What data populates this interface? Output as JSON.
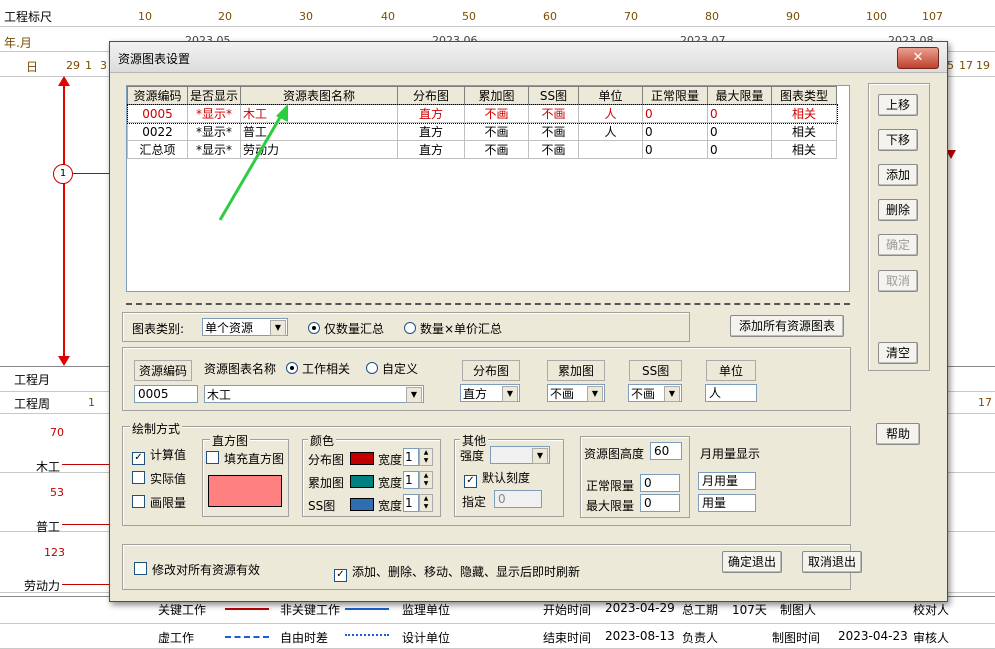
{
  "background": {
    "ruler_label": "工程标尺",
    "ruler_ticks": [
      "10",
      "20",
      "30",
      "40",
      "50",
      "60",
      "70",
      "80",
      "90",
      "100",
      "107"
    ],
    "month_label": "年.月",
    "months": [
      "2023.05",
      "2023.06",
      "2023.07",
      "2023.08"
    ],
    "day_label": "日",
    "days_left": [
      "29",
      "1",
      "3"
    ],
    "days_right": [
      "5",
      "17",
      "19"
    ],
    "node_label": "1",
    "eng_month_label": "工程月",
    "eng_week_label": "工程周",
    "eng_week_first": "1",
    "eng_week_last": "17",
    "resources": [
      {
        "value": "70",
        "name": "木工"
      },
      {
        "value": "53",
        "name": "普工"
      },
      {
        "value": "123",
        "name": "劳动力"
      }
    ],
    "legend": {
      "key_work": "关键工作",
      "non_key_work": "非关键工作",
      "supervisor": "监理单位",
      "start_time_label": "开始时间",
      "start_time": "2023-04-29",
      "total_duration_label": "总工期",
      "total_duration": "107天",
      "drafter_label": "制图人",
      "checker_label": "校对人",
      "virtual_work": "虚工作",
      "free_float": "自由时差",
      "design_unit": "设计单位",
      "end_time_label": "结束时间",
      "end_time": "2023-08-13",
      "owner_label": "负责人",
      "draw_time_label": "制图时间",
      "draw_time": "2023-04-23",
      "reviewer_label": "审核人"
    }
  },
  "dialog": {
    "title": "资源图表设置",
    "close_label": "✕",
    "table": {
      "headers": [
        "资源编码",
        "是否显示",
        "资源表图名称",
        "分布图",
        "累加图",
        "SS图",
        "单位",
        "正常限量",
        "最大限量",
        "图表类型"
      ],
      "rows": [
        [
          "0005",
          "*显示*",
          "木工",
          "直方",
          "不画",
          "不画",
          "人",
          "0",
          "0",
          "相关"
        ],
        [
          "0022",
          "*显示*",
          "普工",
          "直方",
          "不画",
          "不画",
          "人",
          "0",
          "0",
          "相关"
        ],
        [
          "汇总项",
          "*显示*",
          "劳动力",
          "直方",
          "不画",
          "不画",
          "",
          "0",
          "0",
          "相关"
        ]
      ]
    },
    "side_buttons": {
      "up": "上移",
      "down": "下移",
      "add": "添加",
      "delete": "删除",
      "confirm": "确定",
      "cancel": "取消",
      "clear": "清空",
      "help": "帮助"
    },
    "chart_category": {
      "label": "图表类别:",
      "value": "单个资源",
      "radio_qty": "仅数量汇总",
      "radio_qty_price": "数量×单价汇总",
      "add_all_button": "添加所有资源图表"
    },
    "detail": {
      "code_label": "资源编码",
      "code_value": "0005",
      "name_label": "资源图表名称",
      "radio_work": "工作相关",
      "radio_custom": "自定义",
      "name_value": "木工",
      "dist_label": "分布图",
      "dist_value": "直方",
      "accum_label": "累加图",
      "accum_value": "不画",
      "ss_label": "SS图",
      "ss_value": "不画",
      "unit_label": "单位",
      "unit_value": "人"
    },
    "draw": {
      "group_label": "绘制方式",
      "calc_value": "计算值",
      "actual_value": "实际值",
      "draw_limit": "画限量",
      "hist_label": "直方图",
      "fill_hist": "填充直方图",
      "hist_color": "#ff8080",
      "color_label": "颜色",
      "dist_row": "分布图",
      "accum_row": "累加图",
      "ss_row": "SS图",
      "width_label": "宽度",
      "dist_color": "#c00000",
      "accum_color": "#008080",
      "ss_color": "#2f6fb0",
      "width_value": "1",
      "other_label": "其他",
      "strength_label": "强度",
      "default_scale": "默认刻度",
      "specify_label": "指定",
      "specify_value": "0",
      "height_label": "资源图高度",
      "height_value": "60",
      "monthly_label": "月用量显示",
      "normal_limit_label": "正常限量",
      "normal_limit_value": "0",
      "max_limit_label": "最大限量",
      "max_limit_value": "0",
      "monthly_usage": "月用量",
      "usage": "用量"
    },
    "bottom": {
      "apply_all": "修改对所有资源有效",
      "refresh_now": "添加、删除、移动、隐藏、显示后即时刷新",
      "ok_exit": "确定退出",
      "cancel_exit": "取消退出"
    }
  }
}
